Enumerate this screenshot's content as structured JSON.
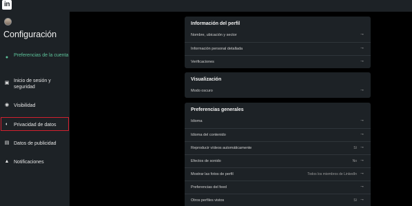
{
  "app": {
    "logo_text": "in"
  },
  "sidebar": {
    "title": "Configuración",
    "items": [
      {
        "label": "Preferencias de la cuenta",
        "icon": "person-icon",
        "glyph": "●",
        "active": true
      },
      {
        "label": "Inicio de sesión y seguridad",
        "icon": "lock-icon",
        "glyph": "▣",
        "active": false
      },
      {
        "label": "Visibilidad",
        "icon": "eye-icon",
        "glyph": "◉",
        "active": false
      },
      {
        "label": "Privacidad de datos",
        "icon": "shield-icon",
        "glyph": "◐",
        "active": false,
        "highlighted": true
      },
      {
        "label": "Datos de publicidad",
        "icon": "ad-icon",
        "glyph": "▤",
        "active": false
      },
      {
        "label": "Notificaciones",
        "icon": "bell-icon",
        "glyph": "▲",
        "active": false
      }
    ]
  },
  "sections": {
    "profile": {
      "title": "Información del perfil",
      "rows": [
        {
          "label": "Nombre, ubicación y sector",
          "value": ""
        },
        {
          "label": "Información personal detallada",
          "value": ""
        },
        {
          "label": "Verificaciones",
          "value": ""
        }
      ]
    },
    "display": {
      "title": "Visualización",
      "rows": [
        {
          "label": "Modo oscuro",
          "value": ""
        }
      ]
    },
    "general": {
      "title": "Preferencias generales",
      "rows": [
        {
          "label": "Idioma",
          "value": ""
        },
        {
          "label": "Idioma del contenido",
          "value": ""
        },
        {
          "label": "Reproducir vídeos automáticamente",
          "value": "Sí"
        },
        {
          "label": "Efectos de sonido",
          "value": "No"
        },
        {
          "label": "Mostrar las fotos de perfil",
          "value": "Todos los miembros de LinkedIn"
        },
        {
          "label": "Preferencias del feed",
          "value": ""
        },
        {
          "label": "Otros perfiles vistos",
          "value": "Sí"
        }
      ]
    }
  },
  "arrow_glyph": "→",
  "colors": {
    "accent": "#5dc39a",
    "highlight": "#d3202f",
    "panel": "#1d2226",
    "background": "#000000"
  }
}
